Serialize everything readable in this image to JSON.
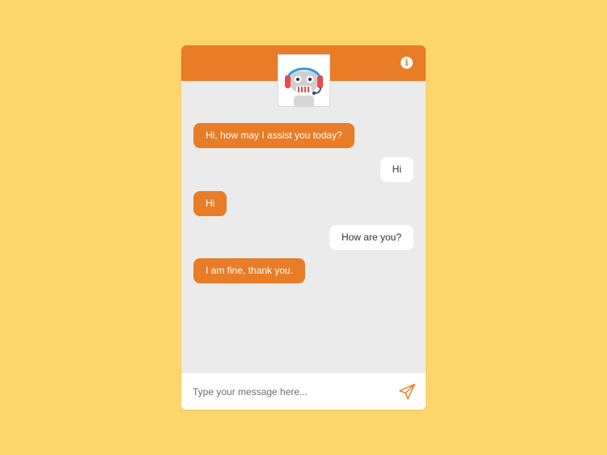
{
  "header": {
    "avatar_icon": "robot-support-agent-icon",
    "info_icon": "info-icon",
    "accent_color": "#E97C26"
  },
  "messages": [
    {
      "sender": "bot",
      "text": "Hi, how may I assist you today?"
    },
    {
      "sender": "user",
      "text": "Hi"
    },
    {
      "sender": "bot",
      "text": "Hi"
    },
    {
      "sender": "user",
      "text": "How are you?"
    },
    {
      "sender": "bot",
      "text": "I am fine, thank you."
    }
  ],
  "composer": {
    "placeholder": "Type your message here...",
    "value": "",
    "send_icon": "paper-plane-icon"
  },
  "colors": {
    "background": "#FFD66B",
    "chat_body": "#EBEBEB",
    "bot_bubble": "#E97C26",
    "user_bubble": "#FFFFFF"
  }
}
